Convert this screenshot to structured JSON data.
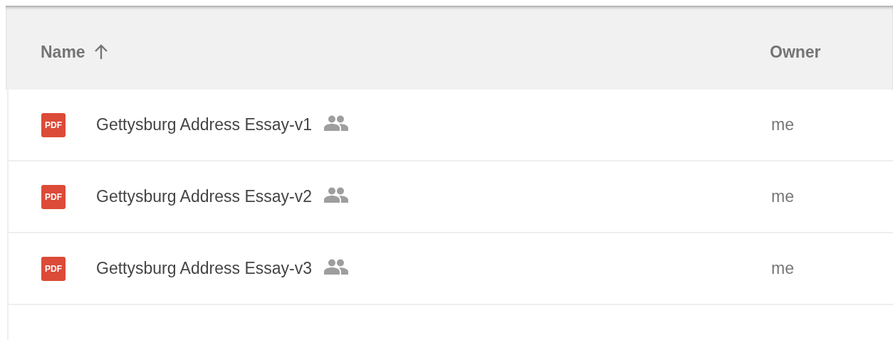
{
  "table": {
    "columns": [
      {
        "label": "Name",
        "sorted_ascending": true
      },
      {
        "label": "Owner",
        "sorted_ascending": false
      }
    ],
    "rows": [
      {
        "file_badge": "PDF",
        "name": "Gettysburg Address Essay-v1",
        "shared": true,
        "owner": "me"
      },
      {
        "file_badge": "PDF",
        "name": "Gettysburg Address Essay-v2",
        "shared": true,
        "owner": "me"
      },
      {
        "file_badge": "PDF",
        "name": "Gettysburg Address Essay-v3",
        "shared": true,
        "owner": "me"
      }
    ]
  }
}
